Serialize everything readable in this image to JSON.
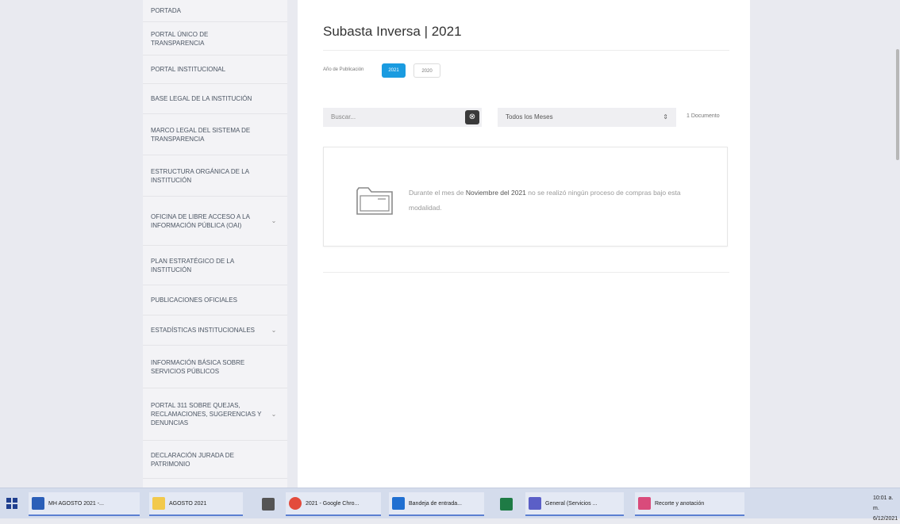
{
  "sidebar": {
    "items": [
      {
        "label": "PORTADA",
        "chevron": false
      },
      {
        "label": "PORTAL ÚNICO DE TRANSPARENCIA",
        "chevron": false
      },
      {
        "label": "PORTAL INSTITUCIONAL",
        "chevron": false
      },
      {
        "label": "BASE LEGAL DE LA INSTITUCIÓN",
        "chevron": false
      },
      {
        "label": "MARCO LEGAL DEL SISTEMA DE TRANSPARENCIA",
        "chevron": false
      },
      {
        "label": "ESTRUCTURA ORGÁNICA DE LA INSTITUCIÓN",
        "chevron": false
      },
      {
        "label": "OFICINA DE LIBRE ACCESO A LA INFORMACIÓN PÚBLICA (OAI)",
        "chevron": true
      },
      {
        "label": "PLAN ESTRATÉGICO DE LA INSTITUCIÓN",
        "chevron": false
      },
      {
        "label": "PUBLICACIONES OFICIALES",
        "chevron": false
      },
      {
        "label": "ESTADÍSTICAS INSTITUCIONALES",
        "chevron": true
      },
      {
        "label": "INFORMACIÓN BÁSICA SOBRE SERVICIOS PÚBLICOS",
        "chevron": false
      },
      {
        "label": "PORTAL 311 SOBRE QUEJAS, RECLAMACIONES, SUGERENCIAS Y DENUNCIAS",
        "chevron": true
      },
      {
        "label": "DECLARACIÓN JURADA DE PATRIMONIO",
        "chevron": false
      }
    ],
    "chevron_glyph": "⌄"
  },
  "main": {
    "title": "Subasta Inversa | 2021",
    "year_label": "Año de Publicación",
    "years": [
      "2021",
      "2020"
    ],
    "selected_year": "2021",
    "search_placeholder": "Buscar...",
    "search_button_glyph": "⊗",
    "month_select_value": "Todos los Meses",
    "month_select_arrow": "⇕",
    "doc_count": "1 Documento",
    "notice": {
      "prefix": "Durante el mes de ",
      "period": "Noviembre del 2021",
      "suffix": " no se realizó ningún proceso de compras bajo esta modalidad."
    }
  },
  "taskbar": {
    "items": [
      {
        "label": "MH AGOSTO 2021 -...",
        "icon": "word-icon",
        "color": "#2b5fb8"
      },
      {
        "label": "AGOSTO 2021",
        "icon": "folder-icon",
        "color": "#f2c94c"
      },
      {
        "label": "",
        "icon": "calculator-icon",
        "color": "#555555"
      },
      {
        "label": "2021 - Google Chro...",
        "icon": "chrome-icon",
        "color": "#e34b3c"
      },
      {
        "label": "Bandeja de entrada...",
        "icon": "outlook-icon",
        "color": "#1f6fd1"
      },
      {
        "label": "",
        "icon": "excel-icon",
        "color": "#1e7b45"
      },
      {
        "label": "General (Servicios ...",
        "icon": "teams-icon",
        "color": "#5b5fc7"
      },
      {
        "label": "Recorte y anotación",
        "icon": "snip-icon",
        "color": "#d94b7b"
      }
    ],
    "clock": {
      "time": "10:01 a. m.",
      "date": "6/12/2021"
    }
  },
  "colors": {
    "accent": "#1a9be0",
    "background": "#e9eaf0",
    "sidebar": "#f3f3f6",
    "taskbar": "#d4dcec"
  }
}
